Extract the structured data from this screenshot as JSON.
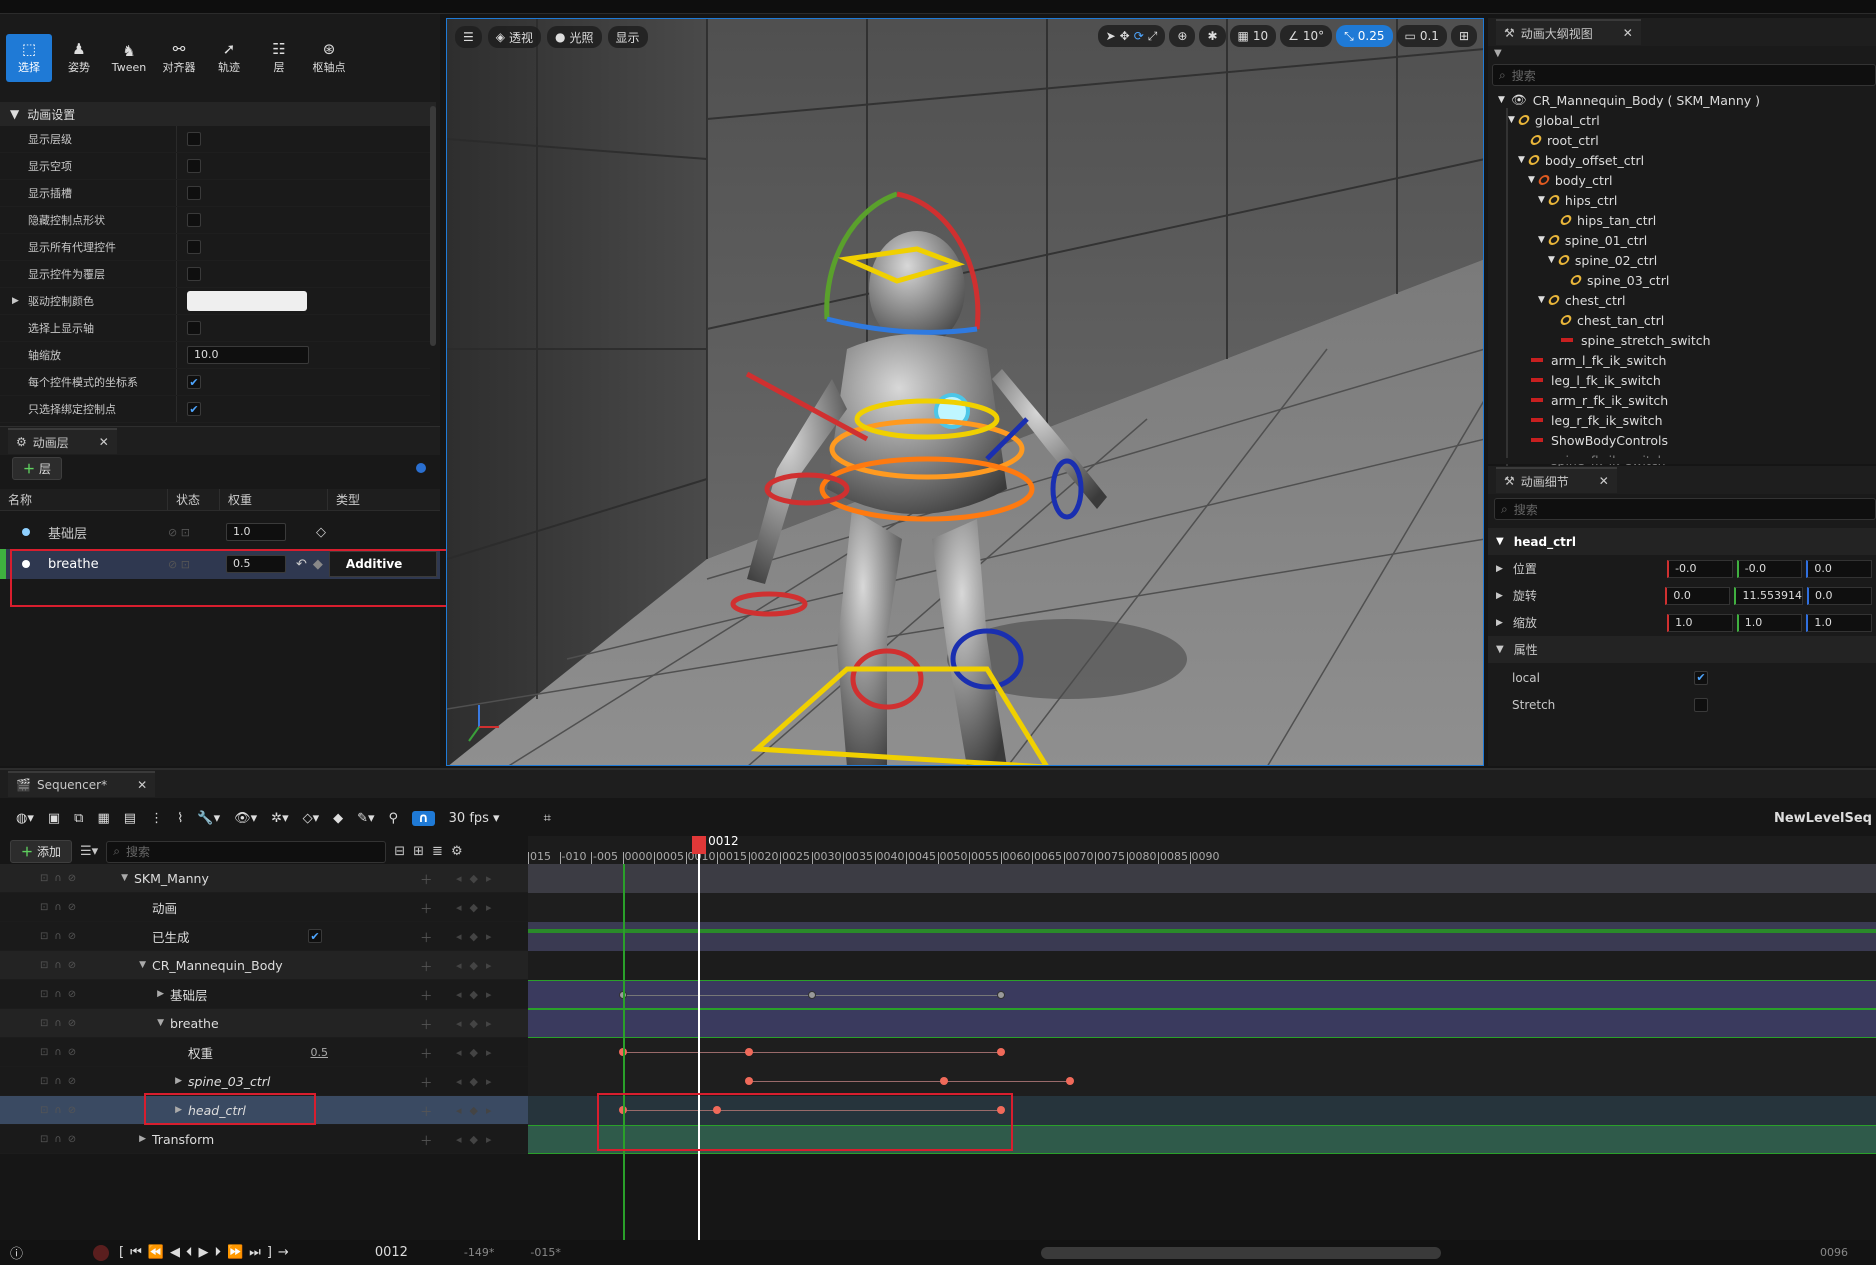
{
  "mode_tools": [
    {
      "label": "选择",
      "icon": "select-icon",
      "active": true
    },
    {
      "label": "姿势",
      "icon": "pose-icon",
      "active": false
    },
    {
      "label": "Tween",
      "icon": "tween-icon",
      "active": false
    },
    {
      "label": "对齐器",
      "icon": "snapper-icon",
      "active": false
    },
    {
      "label": "轨迹",
      "icon": "trails-icon",
      "active": false
    },
    {
      "label": "层",
      "icon": "layers-icon",
      "active": false
    },
    {
      "label": "枢轴点",
      "icon": "pivot-icon",
      "active": false
    }
  ],
  "anim_settings": {
    "header": "动画设置",
    "rows": [
      {
        "label": "显示层级",
        "type": "checkbox",
        "checked": false
      },
      {
        "label": "显示空项",
        "type": "checkbox",
        "checked": false
      },
      {
        "label": "显示插槽",
        "type": "checkbox",
        "checked": false
      },
      {
        "label": "隐藏控制点形状",
        "type": "checkbox",
        "checked": false
      },
      {
        "label": "显示所有代理控件",
        "type": "checkbox",
        "checked": false
      },
      {
        "label": "显示控件为覆层",
        "type": "checkbox",
        "checked": false
      },
      {
        "label": "驱动控制颜色",
        "type": "color",
        "value": "#efefef"
      },
      {
        "label": "选择上显示轴",
        "type": "checkbox",
        "checked": false
      },
      {
        "label": "轴缩放",
        "type": "number",
        "value": "10.0"
      },
      {
        "label": "每个控件模式的坐标系",
        "type": "checkbox",
        "checked": true
      },
      {
        "label": "只选择绑定控制点",
        "type": "checkbox",
        "checked": true
      }
    ]
  },
  "layers_panel": {
    "tab": "动画层",
    "add_label": "层",
    "columns": [
      "名称",
      "状态",
      "权重",
      "类型"
    ],
    "rows": [
      {
        "name": "基础层",
        "weight": "1.0",
        "type": ""
      },
      {
        "name": "breathe",
        "weight": "0.5",
        "type": "Additive"
      }
    ]
  },
  "viewport": {
    "perspective": "透视",
    "lighting": "光照",
    "show": "显示",
    "grid": "10",
    "angle": "10°",
    "scale": "0.25",
    "camera_speed": "0.1"
  },
  "outliner": {
    "tab": "动画大纲视图",
    "search_placeholder": "搜索",
    "nodes": [
      {
        "label": "CR_Mannequin_Body ( SKM_Manny )",
        "depth": 0,
        "kind": "root"
      },
      {
        "label": "global_ctrl",
        "depth": 1,
        "kind": "bone"
      },
      {
        "label": "root_ctrl",
        "depth": 2,
        "kind": "bone"
      },
      {
        "label": "body_offset_ctrl",
        "depth": 2,
        "kind": "bone"
      },
      {
        "label": "body_ctrl",
        "depth": 3,
        "kind": "bone"
      },
      {
        "label": "hips_ctrl",
        "depth": 4,
        "kind": "bone"
      },
      {
        "label": "hips_tan_ctrl",
        "depth": 5,
        "kind": "bone"
      },
      {
        "label": "spine_01_ctrl",
        "depth": 4,
        "kind": "bone"
      },
      {
        "label": "spine_02_ctrl",
        "depth": 5,
        "kind": "bone"
      },
      {
        "label": "spine_03_ctrl",
        "depth": 6,
        "kind": "bone"
      },
      {
        "label": "chest_ctrl",
        "depth": 4,
        "kind": "bone"
      },
      {
        "label": "chest_tan_ctrl",
        "depth": 5,
        "kind": "bone"
      },
      {
        "label": "spine_stretch_switch",
        "depth": 5,
        "kind": "switch"
      },
      {
        "label": "arm_l_fk_ik_switch",
        "depth": 2,
        "kind": "switch"
      },
      {
        "label": "leg_l_fk_ik_switch",
        "depth": 2,
        "kind": "switch"
      },
      {
        "label": "arm_r_fk_ik_switch",
        "depth": 2,
        "kind": "switch"
      },
      {
        "label": "leg_r_fk_ik_switch",
        "depth": 2,
        "kind": "switch"
      },
      {
        "label": "ShowBodyControls",
        "depth": 2,
        "kind": "switch"
      },
      {
        "label": "spine_fk_ik_switch",
        "depth": 2,
        "kind": "switch"
      }
    ]
  },
  "details": {
    "tab": "动画细节",
    "search_placeholder": "搜索",
    "control": "head_ctrl",
    "location_label": "位置",
    "location": [
      "-0.0",
      "-0.0",
      "0.0"
    ],
    "rotation_label": "旋转",
    "rotation": [
      "0.0",
      "11.553914",
      "0.0"
    ],
    "scale_label": "缩放",
    "scale": [
      "1.0",
      "1.0",
      "1.0"
    ],
    "attributes_label": "属性",
    "local_label": "local",
    "local": true,
    "stretch_label": "Stretch",
    "stretch": false
  },
  "sequencer": {
    "tab": "Sequencer*",
    "fps": "30 fps",
    "sequence_name": "NewLevelSeq",
    "add_label": "添加",
    "search_placeholder": "搜索",
    "current_frame": "0012",
    "ruler_labels": [
      "015",
      "-010",
      "-005",
      "0000",
      "0005",
      "0010",
      "0015",
      "0020",
      "0025",
      "0030",
      "0035",
      "0040",
      "0045",
      "0050",
      "0055",
      "0060",
      "0065",
      "0070",
      "0075",
      "0080",
      "0085",
      "0090"
    ],
    "tracks": [
      {
        "label": "SKM_Manny",
        "indent": 0,
        "expander": "down",
        "extra": ""
      },
      {
        "label": "动画",
        "indent": 1,
        "expander": "",
        "extra": ""
      },
      {
        "label": "已生成",
        "indent": 1,
        "expander": "",
        "extra": "checkbox"
      },
      {
        "label": "CR_Mannequin_Body",
        "indent": 1,
        "expander": "down",
        "extra": ""
      },
      {
        "label": "基础层",
        "indent": 2,
        "expander": "right",
        "extra": ""
      },
      {
        "label": "breathe",
        "indent": 2,
        "expander": "down",
        "extra": ""
      },
      {
        "label": "权重",
        "indent": 3,
        "expander": "",
        "extra": "0.5"
      },
      {
        "label": "spine_03_ctrl",
        "indent": 3,
        "expander": "right",
        "extra": ""
      },
      {
        "label": "head_ctrl",
        "indent": 3,
        "expander": "right",
        "extra": ""
      },
      {
        "label": "Transform",
        "indent": 1,
        "expander": "right",
        "extra": ""
      }
    ],
    "keyframes": {
      "base_layer": [
        0,
        30,
        60
      ],
      "weight": [
        0,
        20,
        60
      ],
      "spine_03_ctrl": [
        20,
        51,
        71
      ],
      "head_ctrl": [
        0,
        15,
        60
      ]
    },
    "playback_frame": "0012",
    "range_start": "-149*",
    "range_end": "-015*",
    "range_right": "0096"
  }
}
